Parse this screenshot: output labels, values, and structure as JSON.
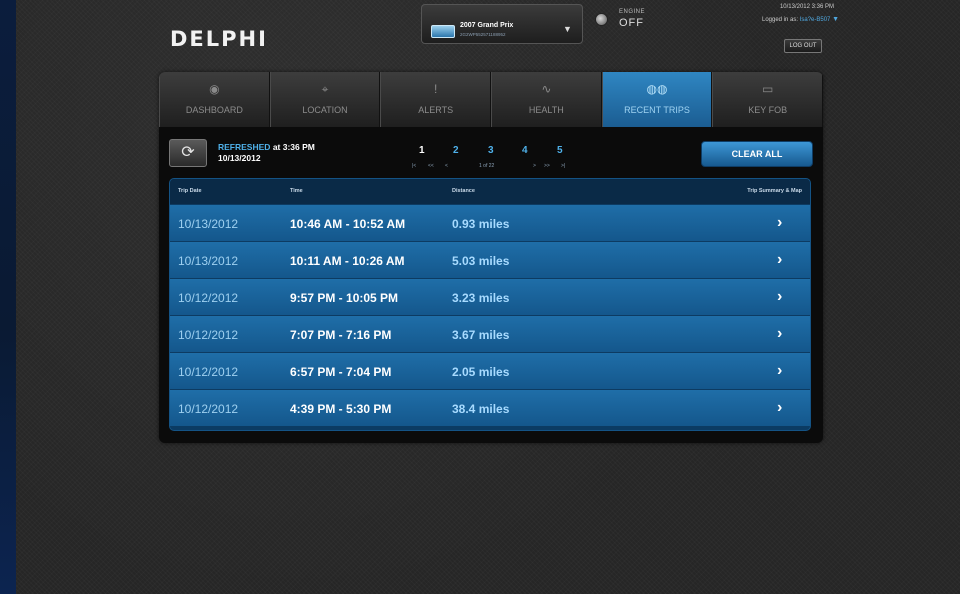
{
  "brand": {
    "logo_text": "DELPHI"
  },
  "vehicle": {
    "name": "2007 Grand Prix",
    "vin": "2G2WP552571188952",
    "chevron_icon": "chevron-down-icon"
  },
  "engine": {
    "label": "ENGINE",
    "status": "OFF"
  },
  "session": {
    "datetime": "10/13/2012 3:36 PM",
    "logged_in_prefix": "Logged in as:",
    "user": "Isa?e-B507",
    "logout_label": "LOG OUT"
  },
  "tabs": [
    {
      "label": "DASHBOARD",
      "icon": "speedometer-icon",
      "glyph": "◉",
      "active": false
    },
    {
      "label": "LOCATION",
      "icon": "map-pin-icon",
      "glyph": "⌖",
      "active": false
    },
    {
      "label": "ALERTS",
      "icon": "exclamation-icon",
      "glyph": "!",
      "active": false
    },
    {
      "label": "HEALTH",
      "icon": "heartbeat-icon",
      "glyph": "∿",
      "active": false
    },
    {
      "label": "RECENT TRIPS",
      "icon": "trips-icon",
      "glyph": "◍◍",
      "active": true
    },
    {
      "label": "KEY FOB",
      "icon": "key-fob-icon",
      "glyph": "▭",
      "active": false
    }
  ],
  "refresh": {
    "prefix": "REFRESHED",
    "time": "at 3:36 PM",
    "date": "10/13/2012",
    "icon": "refresh-icon"
  },
  "pagination": {
    "pages": [
      "1",
      "2",
      "3",
      "4",
      "5"
    ],
    "current": "1",
    "first": "|<",
    "prev_many": "<<",
    "prev": "<",
    "of_text": "1 of 22",
    "next": ">",
    "next_many": ">>",
    "last": ">|"
  },
  "clear_all_label": "CLEAR ALL",
  "table": {
    "headers": {
      "date": "Trip Date",
      "time": "Time",
      "distance": "Distance",
      "summary": "Trip Summary & Map"
    },
    "rows": [
      {
        "date": "10/13/2012",
        "time": "10:46 AM - 10:52 AM",
        "distance": "0.93 miles"
      },
      {
        "date": "10/13/2012",
        "time": "10:11 AM - 10:26 AM",
        "distance": "5.03 miles"
      },
      {
        "date": "10/12/2012",
        "time": "9:57 PM - 10:05 PM",
        "distance": "3.23 miles"
      },
      {
        "date": "10/12/2012",
        "time": "7:07 PM - 7:16 PM",
        "distance": "3.67 miles"
      },
      {
        "date": "10/12/2012",
        "time": "6:57 PM - 7:04 PM",
        "distance": "2.05 miles"
      },
      {
        "date": "10/12/2012",
        "time": "4:39 PM - 5:30 PM",
        "distance": "38.4 miles"
      }
    ]
  },
  "colors": {
    "accent": "#4fb1ea",
    "active_tab": "#1b5d92",
    "row": "#14578c",
    "background": "#262626"
  }
}
